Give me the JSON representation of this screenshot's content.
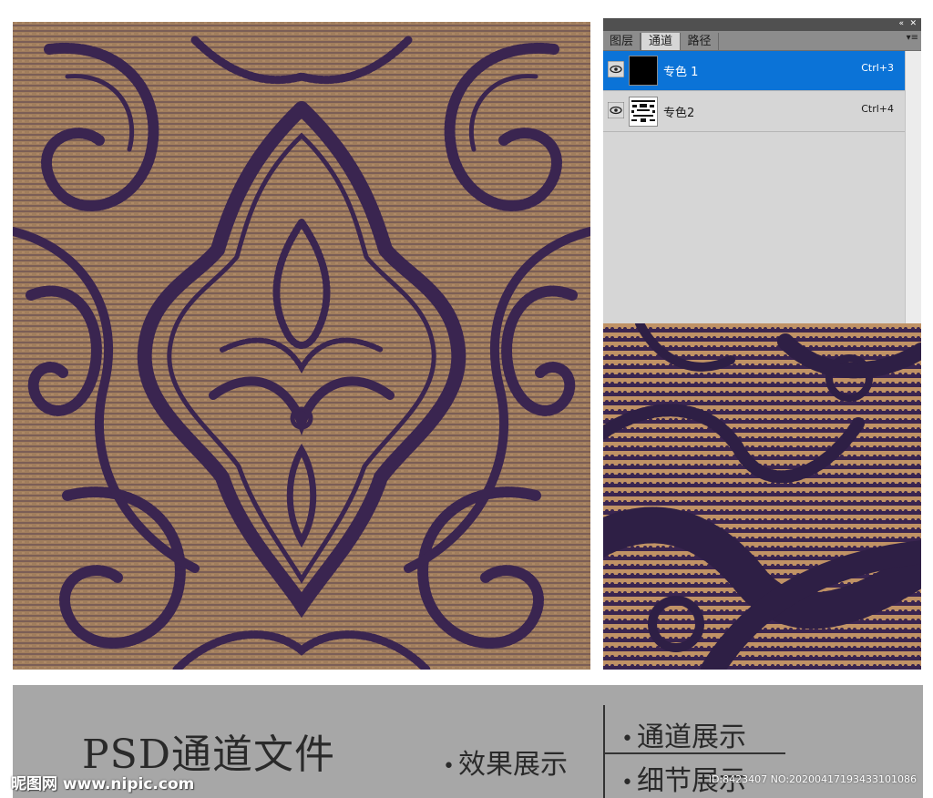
{
  "panel": {
    "tabs": [
      {
        "label": "图层",
        "active": false
      },
      {
        "label": "通道",
        "active": true
      },
      {
        "label": "路径",
        "active": false
      }
    ],
    "collapse_icon": "«",
    "menu_icon": "▾≡",
    "channels": [
      {
        "name": "专色 1",
        "shortcut": "Ctrl+3",
        "selected": true,
        "thumb_color": "#000000"
      },
      {
        "name": "专色2",
        "shortcut": "Ctrl+4",
        "selected": false,
        "thumb_color": "#ffffff"
      }
    ]
  },
  "colors": {
    "pattern_ink": "#3a2550",
    "pattern_base": "#a37f5e",
    "detail_base": "#c39467",
    "selection_blue": "#0b73d7",
    "banner_bg": "#a7a7a7"
  },
  "banner": {
    "title": "PSD通道文件",
    "effect_label": "效果展示",
    "channel_label": "通道展示",
    "detail_label": "细节展示"
  },
  "watermark": {
    "logo": "昵图网 www.nipic.com",
    "id_text": "ID:8423407 NO:20200417193433101086"
  }
}
